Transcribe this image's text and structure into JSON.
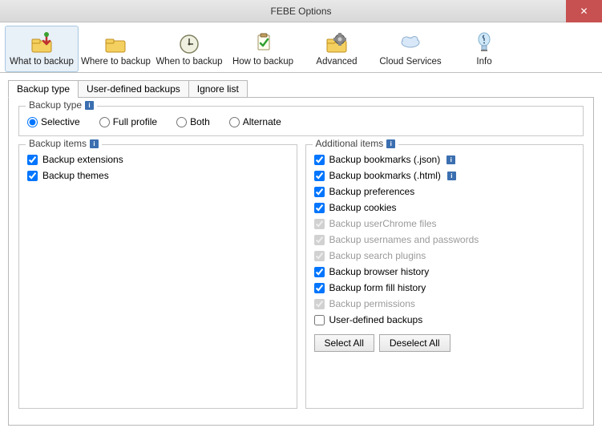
{
  "window": {
    "title": "FEBE Options",
    "close": "✕"
  },
  "toolbar": [
    {
      "label": "What to backup",
      "icon": "what",
      "selected": true
    },
    {
      "label": "Where to backup",
      "icon": "where",
      "selected": false
    },
    {
      "label": "When to backup",
      "icon": "when",
      "selected": false
    },
    {
      "label": "How to backup",
      "icon": "how",
      "selected": false
    },
    {
      "label": "Advanced",
      "icon": "advanced",
      "selected": false
    },
    {
      "label": "Cloud Services",
      "icon": "cloud",
      "selected": false
    },
    {
      "label": "Info",
      "icon": "info",
      "selected": false
    }
  ],
  "tabs": [
    {
      "label": "Backup type",
      "active": true
    },
    {
      "label": "User-defined backups",
      "active": false
    },
    {
      "label": "Ignore list",
      "active": false
    }
  ],
  "backupType": {
    "legend": "Backup type",
    "options": [
      {
        "label": "Selective",
        "checked": true
      },
      {
        "label": "Full profile",
        "checked": false
      },
      {
        "label": "Both",
        "checked": false
      },
      {
        "label": "Alternate",
        "checked": false
      }
    ]
  },
  "backupItems": {
    "legend": "Backup items",
    "items": [
      {
        "label": "Backup extensions",
        "checked": true,
        "disabled": false,
        "info": false
      },
      {
        "label": "Backup themes",
        "checked": true,
        "disabled": false,
        "info": false
      }
    ]
  },
  "additionalItems": {
    "legend": "Additional items",
    "items": [
      {
        "label": "Backup bookmarks (.json)",
        "checked": true,
        "disabled": false,
        "info": true
      },
      {
        "label": "Backup bookmarks (.html)",
        "checked": true,
        "disabled": false,
        "info": true
      },
      {
        "label": "Backup preferences",
        "checked": true,
        "disabled": false,
        "info": false
      },
      {
        "label": "Backup cookies",
        "checked": true,
        "disabled": false,
        "info": false
      },
      {
        "label": "Backup userChrome files",
        "checked": true,
        "disabled": true,
        "info": false
      },
      {
        "label": "Backup usernames and passwords",
        "checked": true,
        "disabled": true,
        "info": false
      },
      {
        "label": "Backup search plugins",
        "checked": true,
        "disabled": true,
        "info": false
      },
      {
        "label": "Backup browser history",
        "checked": true,
        "disabled": false,
        "info": false
      },
      {
        "label": "Backup form fill history",
        "checked": true,
        "disabled": false,
        "info": false
      },
      {
        "label": "Backup permissions",
        "checked": true,
        "disabled": true,
        "info": false
      },
      {
        "label": "User-defined backups",
        "checked": false,
        "disabled": false,
        "info": false
      }
    ],
    "selectAll": "Select All",
    "deselectAll": "Deselect All"
  }
}
